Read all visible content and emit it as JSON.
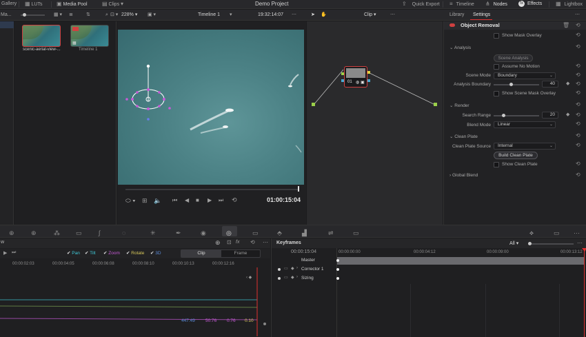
{
  "menubar": {
    "gallery": "Gallery",
    "luts": "LUTs",
    "media_pool": "Media Pool",
    "clips": "Clips",
    "project_title": "Demo Project",
    "quick_export": "Quick Export",
    "timeline": "Timeline",
    "nodes": "Nodes",
    "effects": "Effects",
    "lightbox": "Lightbox"
  },
  "toolbar": {
    "left_label": "Ma...",
    "zoom": "228%",
    "timeline_name": "Timeline 1",
    "timecode": "19:32:14:07",
    "clip_mode": "Clip"
  },
  "thumbnails": [
    {
      "label": "scenic-aerial-view-..."
    },
    {
      "label": "Timeline 1"
    }
  ],
  "viewer": {
    "timecode": "01:00:15:04"
  },
  "node": {
    "number": "01"
  },
  "panel_tabs": {
    "library": "Library",
    "settings": "Settings"
  },
  "settings": {
    "title": "Object Removal",
    "show_mask_overlay": "Show Mask Overlay",
    "analysis_header": "Analysis",
    "scene_analysis": "Scene Analysis",
    "assume_no_motion": "Assume No Motion",
    "scene_mode_label": "Scene Mode",
    "scene_mode_value": "Boundary",
    "analysis_boundary_label": "Analysis Boundary",
    "analysis_boundary_value": "40",
    "show_scene_mask_overlay": "Show Scene Mask Overlay",
    "render_header": "Render",
    "search_range_label": "Search Range",
    "search_range_value": "20",
    "blend_mode_label": "Blend Mode",
    "blend_mode_value": "Linear",
    "clean_plate_header": "Clean Plate",
    "clean_plate_source_label": "Clean Plate Source",
    "clean_plate_source_value": "Internal",
    "build_clean_plate": "Build Clean Plate",
    "show_clean_plate": "Show Clean Plate",
    "global_blend_header": "Global Blend"
  },
  "curves": {
    "left_label": "w",
    "channels": [
      {
        "name": "Pan",
        "color": "#3fc8d8"
      },
      {
        "name": "Tilt",
        "color": "#3fc8d8"
      },
      {
        "name": "Zoom",
        "color": "#c85ad8"
      },
      {
        "name": "Rotate",
        "color": "#d8c85a"
      },
      {
        "name": "3D",
        "color": "#5a8ad8"
      }
    ],
    "clip_tab": "Clip",
    "frame_tab": "Frame",
    "ruler": [
      "00:00:02:03",
      "00:00:04:05",
      "00:00:06:08",
      "00:00:08:10",
      "00:00:10:13",
      "00:00:12:16"
    ],
    "values": [
      {
        "text": "447.49",
        "color": "#5a8ad8"
      },
      {
        "text": "50.76",
        "color": "#c85ad8"
      },
      {
        "text": "0.76",
        "color": "#c85ad8"
      },
      {
        "text": "0.10",
        "color": "#d8c85a"
      }
    ]
  },
  "keyframes": {
    "title": "Keyframes",
    "filter": "All",
    "current_tc": "00:00:15:04",
    "ruler": [
      "00:00:00:00",
      "00:00:04:12",
      "00:00:09:00",
      "00:00:13:12"
    ],
    "tracks": [
      "Master",
      "Corrector 1",
      "Sizing"
    ]
  }
}
